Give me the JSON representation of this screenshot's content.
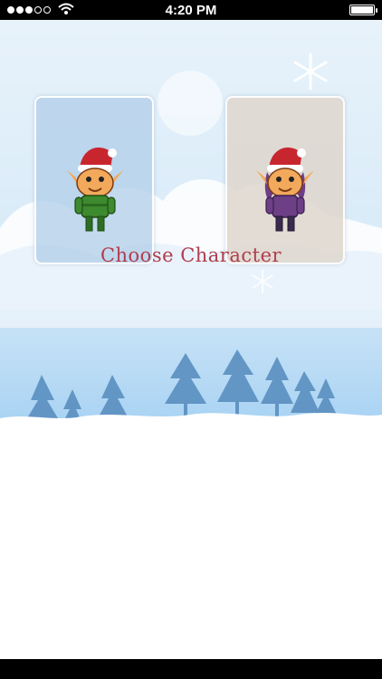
{
  "status_bar": {
    "time": "4:20 PM"
  },
  "characters": [
    {
      "id": "boy-elf",
      "theme_color": "#3e8a2f"
    },
    {
      "id": "girl-elf",
      "theme_color": "#6d3f86"
    }
  ],
  "title": "Choose Character",
  "colors": {
    "sky": "#d7eaf8",
    "snow": "#ffffff",
    "trees": "#5a8fbf",
    "title": "#b03d4d"
  }
}
